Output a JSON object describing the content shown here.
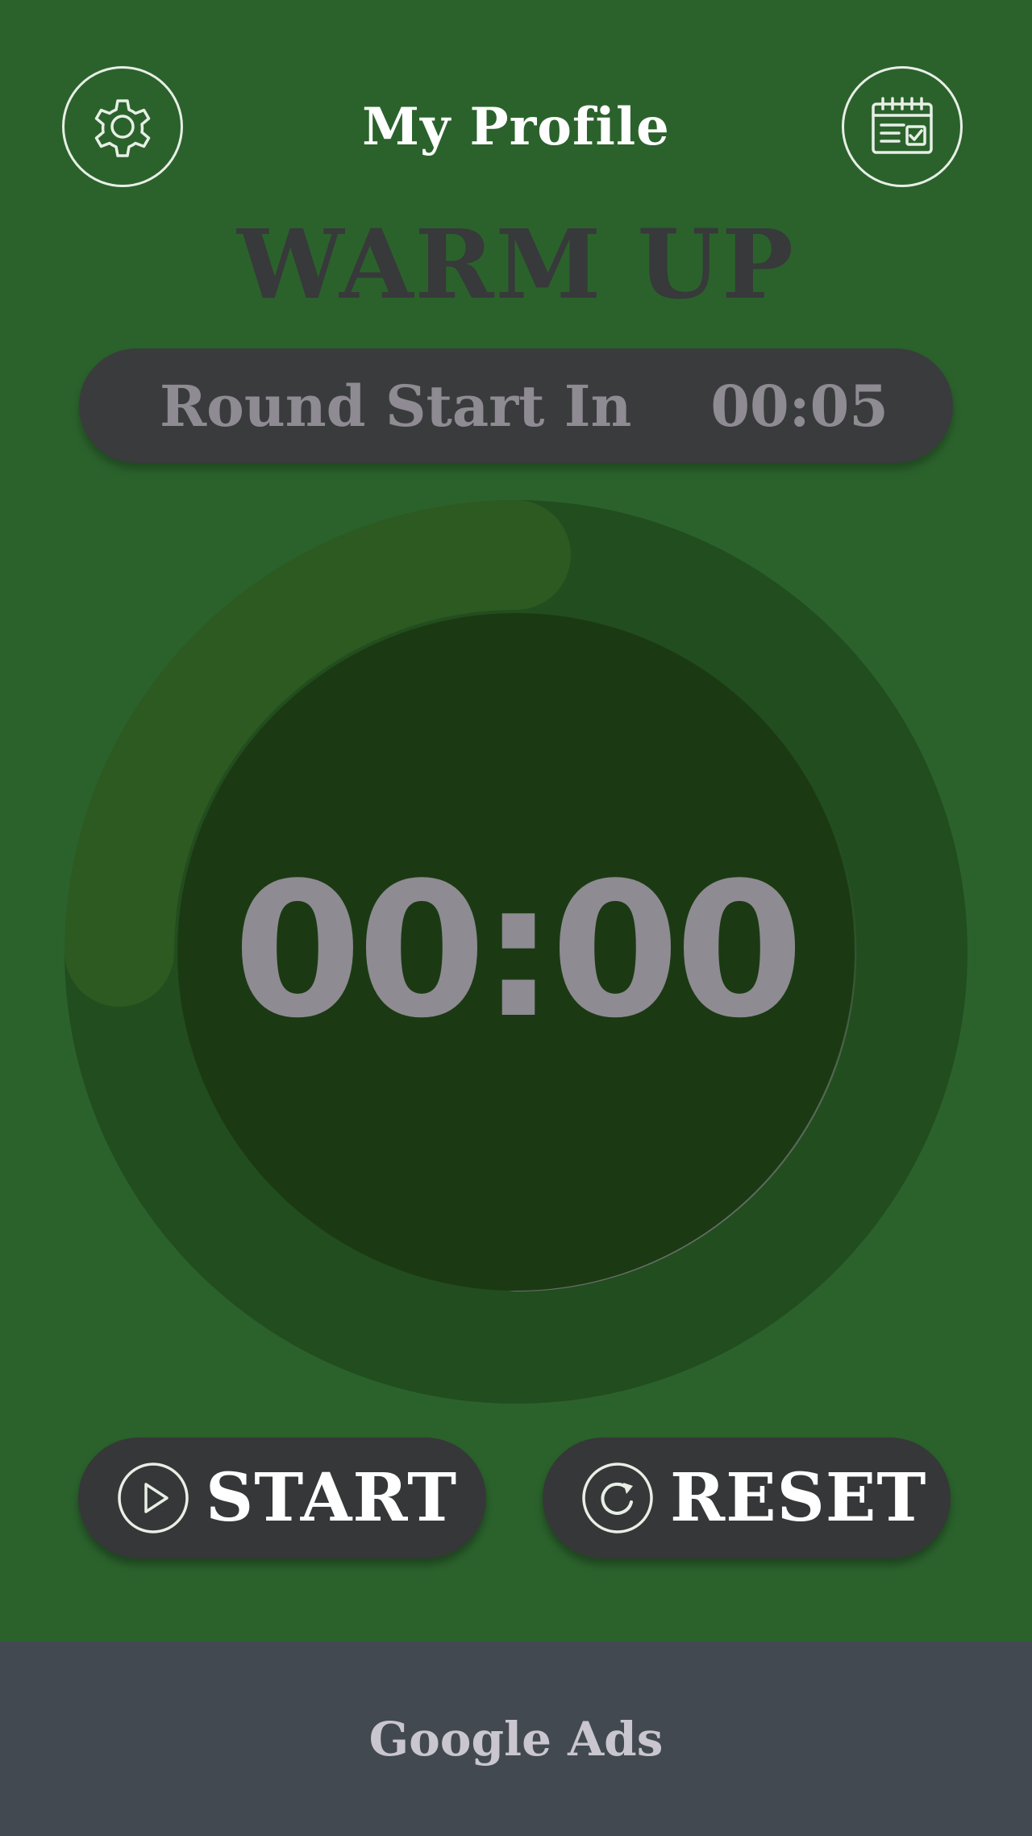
{
  "header": {
    "title": "My Profile",
    "settings_icon": "gear-icon",
    "calendar_icon": "calendar-check-icon"
  },
  "workout": {
    "phase": "WARM UP",
    "round_label": "Round Start In",
    "round_countdown": "00:05"
  },
  "timer": {
    "display": "00:00"
  },
  "controls": {
    "start_label": "START",
    "start_icon": "play-icon",
    "reset_label": "RESET",
    "reset_icon": "reset-icon"
  },
  "ads": {
    "label": "Google Ads"
  },
  "colors": {
    "background": "#2b622c",
    "pill": "#3a3b3d",
    "muted_text": "#8e8b92",
    "phase_text": "#37393a",
    "ads_bar": "#434950"
  }
}
